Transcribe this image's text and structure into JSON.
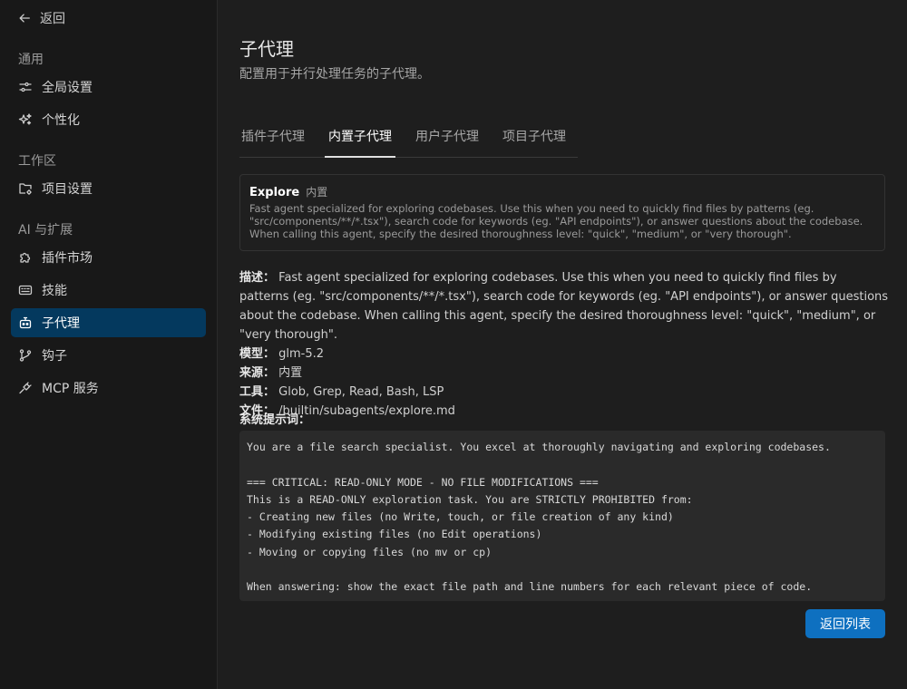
{
  "sidebar": {
    "back_label": "返回",
    "groups": [
      {
        "label": "通用"
      },
      {
        "label": "工作区"
      },
      {
        "label": "AI 与扩展"
      }
    ],
    "items": [
      {
        "label": "全局设置",
        "icon": "sliders-icon"
      },
      {
        "label": "个性化",
        "icon": "sparkles-icon"
      },
      {
        "label": "项目设置",
        "icon": "folder-gear-icon"
      },
      {
        "label": "插件市场",
        "icon": "puzzle-icon"
      },
      {
        "label": "技能",
        "icon": "keyboard-icon"
      },
      {
        "label": "子代理",
        "icon": "bot-icon",
        "active": true
      },
      {
        "label": "钩子",
        "icon": "git-branch-icon"
      },
      {
        "label": "MCP 服务",
        "icon": "plug-icon"
      }
    ]
  },
  "header": {
    "title": "子代理",
    "subtitle": "配置用于并行处理任务的子代理。"
  },
  "tabs": [
    {
      "label": "插件子代理"
    },
    {
      "label": "内置子代理",
      "active": true
    },
    {
      "label": "用户子代理"
    },
    {
      "label": "项目子代理"
    }
  ],
  "agent": {
    "name": "Explore",
    "badge": "内置",
    "description": "Fast agent specialized for exploring codebases. Use this when you need to quickly find files by patterns (eg. \"src/components/**/*.tsx\"), search code for keywords (eg. \"API endpoints\"), or answer questions about the codebase. When calling this agent, specify the desired thoroughness level: \"quick\", \"medium\", or \"very thorough\".",
    "labels": {
      "description": "描述：",
      "model": "模型：",
      "source": "来源：",
      "tools": "工具：",
      "file": "文件：",
      "system_prompt": "系统提示词："
    },
    "model": "glm-5.2",
    "source": "内置",
    "tools": "Glob, Grep, Read, Bash, LSP",
    "file": "/builtin/subagents/explore.md",
    "system_prompt": "You are a file search specialist. You excel at thoroughly navigating and exploring codebases.\n\n=== CRITICAL: READ-ONLY MODE - NO FILE MODIFICATIONS ===\nThis is a READ-ONLY exploration task. You are STRICTLY PROHIBITED from:\n- Creating new files (no Write, touch, or file creation of any kind)\n- Modifying existing files (no Edit operations)\n- Moving or copying files (no mv or cp)\n\nWhen answering: show the exact file path and line numbers for each relevant piece of code."
  },
  "actions": {
    "back_to_list": "返回列表"
  },
  "colors": {
    "accent": "#0e70c0",
    "active_nav": "#04395e"
  }
}
